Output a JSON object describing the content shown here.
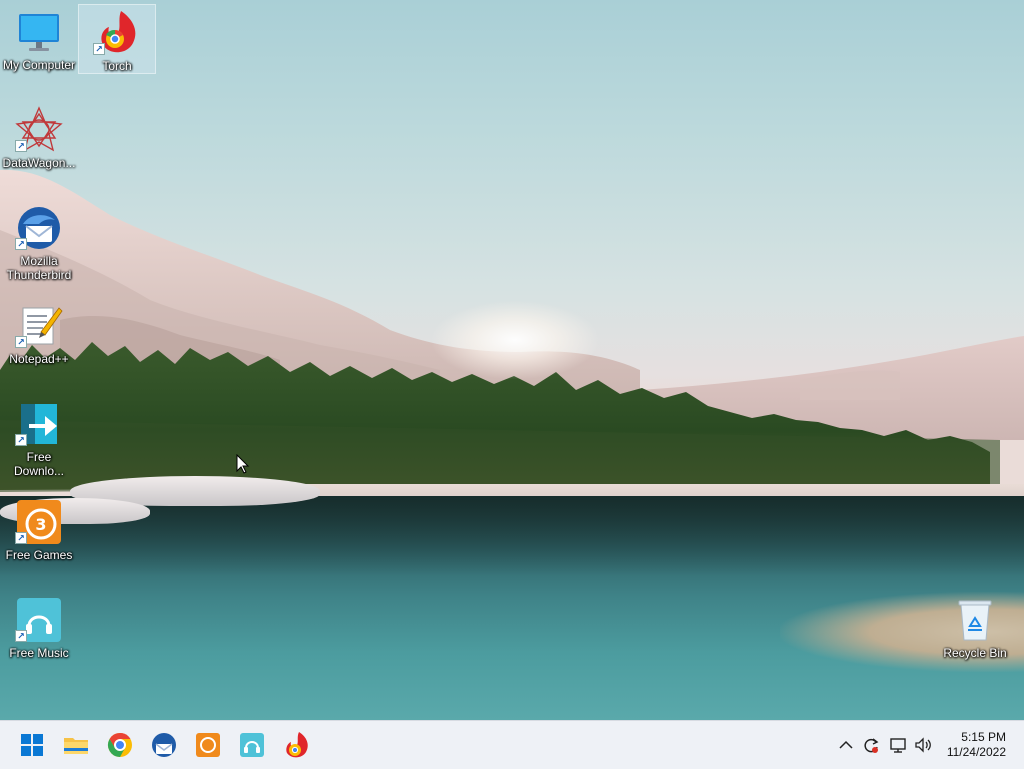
{
  "desktop": {
    "icons": [
      {
        "label": "My Computer",
        "icon": "monitor-icon"
      },
      {
        "label": "Torch",
        "icon": "torch-browser-icon"
      },
      {
        "label": "DataWagon...",
        "icon": "datawagon-icon"
      },
      {
        "label": "Mozilla\nThunderbird",
        "icon": "thunderbird-icon"
      },
      {
        "label": "Notepad++",
        "icon": "notepad-plus-plus-icon"
      },
      {
        "label": "Free\nDownlo...",
        "icon": "free-download-icon"
      },
      {
        "label": "Free Games",
        "icon": "free-games-icon"
      },
      {
        "label": "Free Music",
        "icon": "free-music-icon"
      },
      {
        "label": "Recycle Bin",
        "icon": "recycle-bin-icon"
      }
    ]
  },
  "taskbar": {
    "apps": [
      "start-icon",
      "file-explorer-icon",
      "chrome-icon",
      "thunderbird-icon",
      "free-games-icon",
      "free-music-icon",
      "torch-browser-icon"
    ],
    "tray": [
      "chevron-up-icon",
      "update-sync-icon",
      "network-icon",
      "volume-icon"
    ],
    "clock": {
      "time": "5:15 PM",
      "date": "11/24/2022"
    }
  },
  "colors": {
    "taskbar_bg": "#eef1f6",
    "accent": "#0067c0"
  }
}
